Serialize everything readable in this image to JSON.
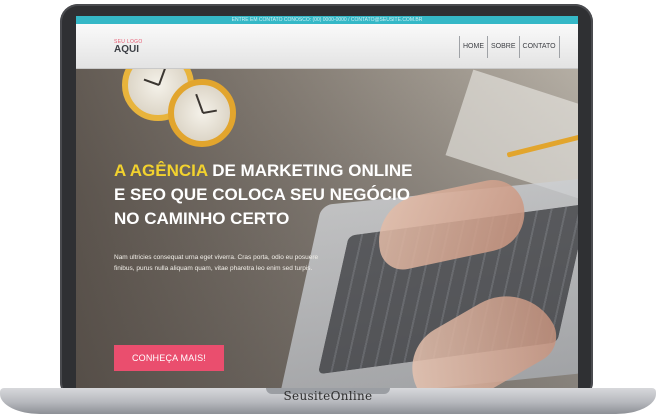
{
  "topbar": {
    "text": "ENTRE EM CONTATO CONOSCO: (00) 0000-0000 / CONTATO@SEUSITE.COM.BR"
  },
  "logo": {
    "small": "SEU LOGO",
    "main": "AQUI"
  },
  "nav": {
    "items": [
      "HOME",
      "SOBRE",
      "CONTATO"
    ]
  },
  "hero": {
    "headline_highlight": "A AGÊNCIA",
    "headline_rest": " DE MARKETING ONLINE E SEO QUE COLOCA SEU NEGÓCIO NO CAMINHO CERTO",
    "subtext": "Nam ultricies consequat urna eget viverra. Cras porta, odio eu posuere finibus, purus nulla aliquam quam, vitae pharetra leo enim sed turpis.",
    "cta_label": "CONHEÇA MAIS!"
  },
  "device": {
    "brand": "SeusiteOnline"
  },
  "colors": {
    "accent_teal": "#35b8c7",
    "headline_yellow": "#f2d22e",
    "cta_pink": "#ea4e6e"
  }
}
